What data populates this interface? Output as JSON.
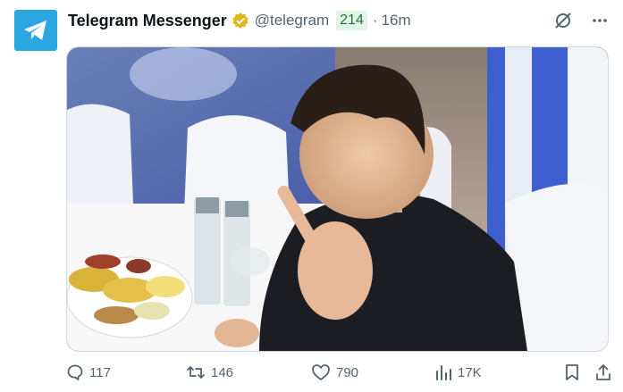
{
  "account": {
    "name": "Telegram Messenger",
    "handle": "@telegram",
    "badge_count": "214",
    "separator": "·",
    "time": "16m"
  },
  "media": {
    "icon": "photo-image"
  },
  "actions": {
    "replies": "117",
    "retweets": "146",
    "likes": "790",
    "views": "17K"
  },
  "colors": {
    "brand": "#2aa6e0",
    "verified": "#e2b719",
    "muted": "#536471",
    "badge_text": "#1e7a33",
    "badge_bg": "#e3f5e6"
  },
  "icons": [
    "telegram-logo-icon",
    "verified-badge-icon",
    "grok-icon",
    "more-icon",
    "reply-icon",
    "retweet-icon",
    "like-icon",
    "views-icon",
    "bookmark-icon",
    "share-icon"
  ]
}
